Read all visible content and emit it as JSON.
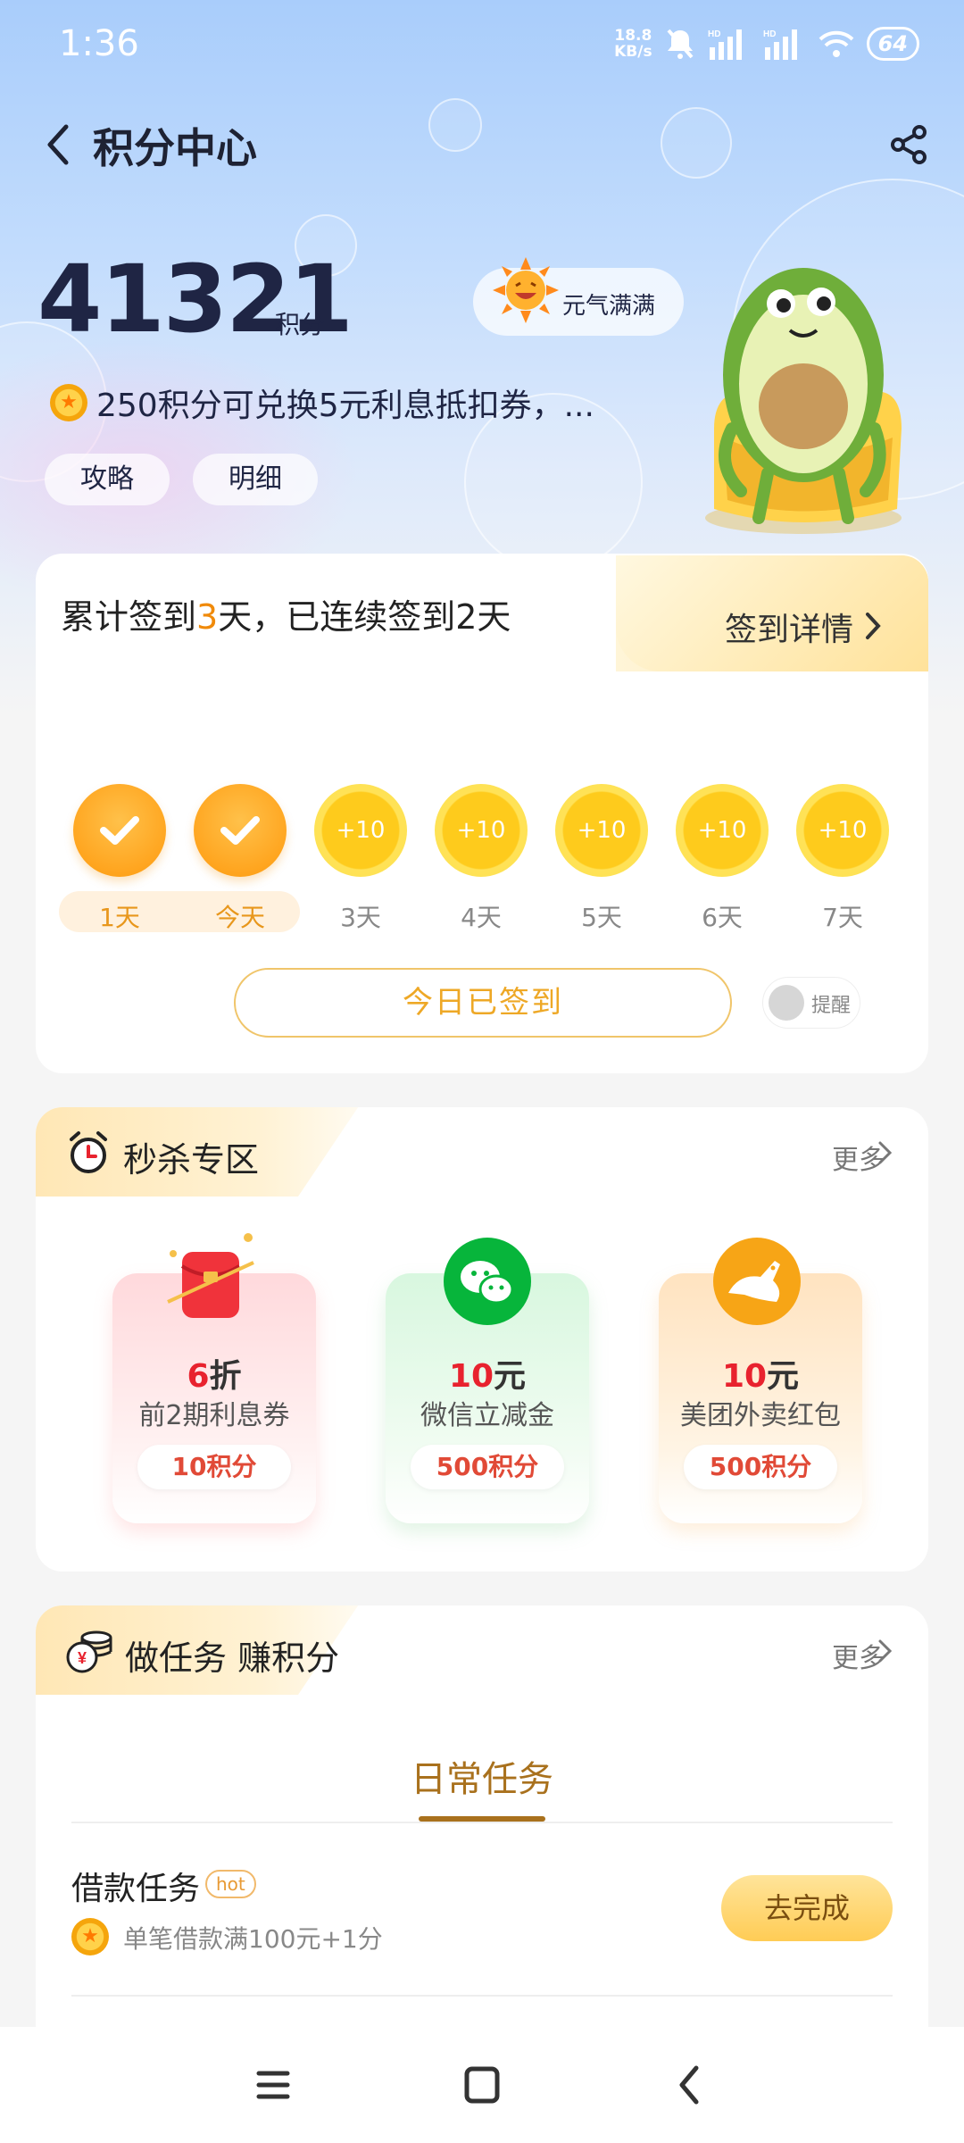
{
  "status_bar": {
    "time": "1:36",
    "net_speed_value": "18.8",
    "net_speed_unit": "KB/s",
    "battery": "64"
  },
  "header": {
    "title": "积分中心"
  },
  "points": {
    "value": "41321",
    "unit": "积分",
    "mood": "元气满满",
    "tip": "250积分可兑换5元利息抵扣券，...",
    "strategy_label": "攻略",
    "detail_label": "明细"
  },
  "checkin": {
    "title_prefix": "累计签到",
    "title_count": "3",
    "title_suffix": "天，已连续签到2天",
    "detail_label": "签到详情",
    "days": [
      {
        "label": "1天",
        "reward": "",
        "done": true
      },
      {
        "label": "今天",
        "reward": "",
        "done": true
      },
      {
        "label": "3天",
        "reward": "+10",
        "done": false
      },
      {
        "label": "4天",
        "reward": "+10",
        "done": false
      },
      {
        "label": "5天",
        "reward": "+10",
        "done": false
      },
      {
        "label": "6天",
        "reward": "+10",
        "done": false
      },
      {
        "label": "7天",
        "reward": "+10",
        "done": false
      }
    ],
    "button_label": "今日已签到",
    "remind_label": "提醒"
  },
  "flash_sale": {
    "title": "秒杀专区",
    "more_label": "更多",
    "offers": [
      {
        "value": "6",
        "unit": "折",
        "name": "前2期利息券",
        "price": "10积分"
      },
      {
        "value": "10",
        "unit": "元",
        "name": "微信立减金",
        "price": "500积分"
      },
      {
        "value": "10",
        "unit": "元",
        "name": "美团外卖红包",
        "price": "500积分"
      }
    ]
  },
  "tasks": {
    "title": "做任务 赚积分",
    "more_label": "更多",
    "tab": "日常任务",
    "items": [
      {
        "name": "借款任务",
        "badge": "hot",
        "desc": "单笔借款满100元+1分",
        "button": "去完成"
      }
    ]
  },
  "colors": {
    "accent": "#f08a0a",
    "price_red": "#e8222e",
    "tab_brown": "#a9711d"
  }
}
